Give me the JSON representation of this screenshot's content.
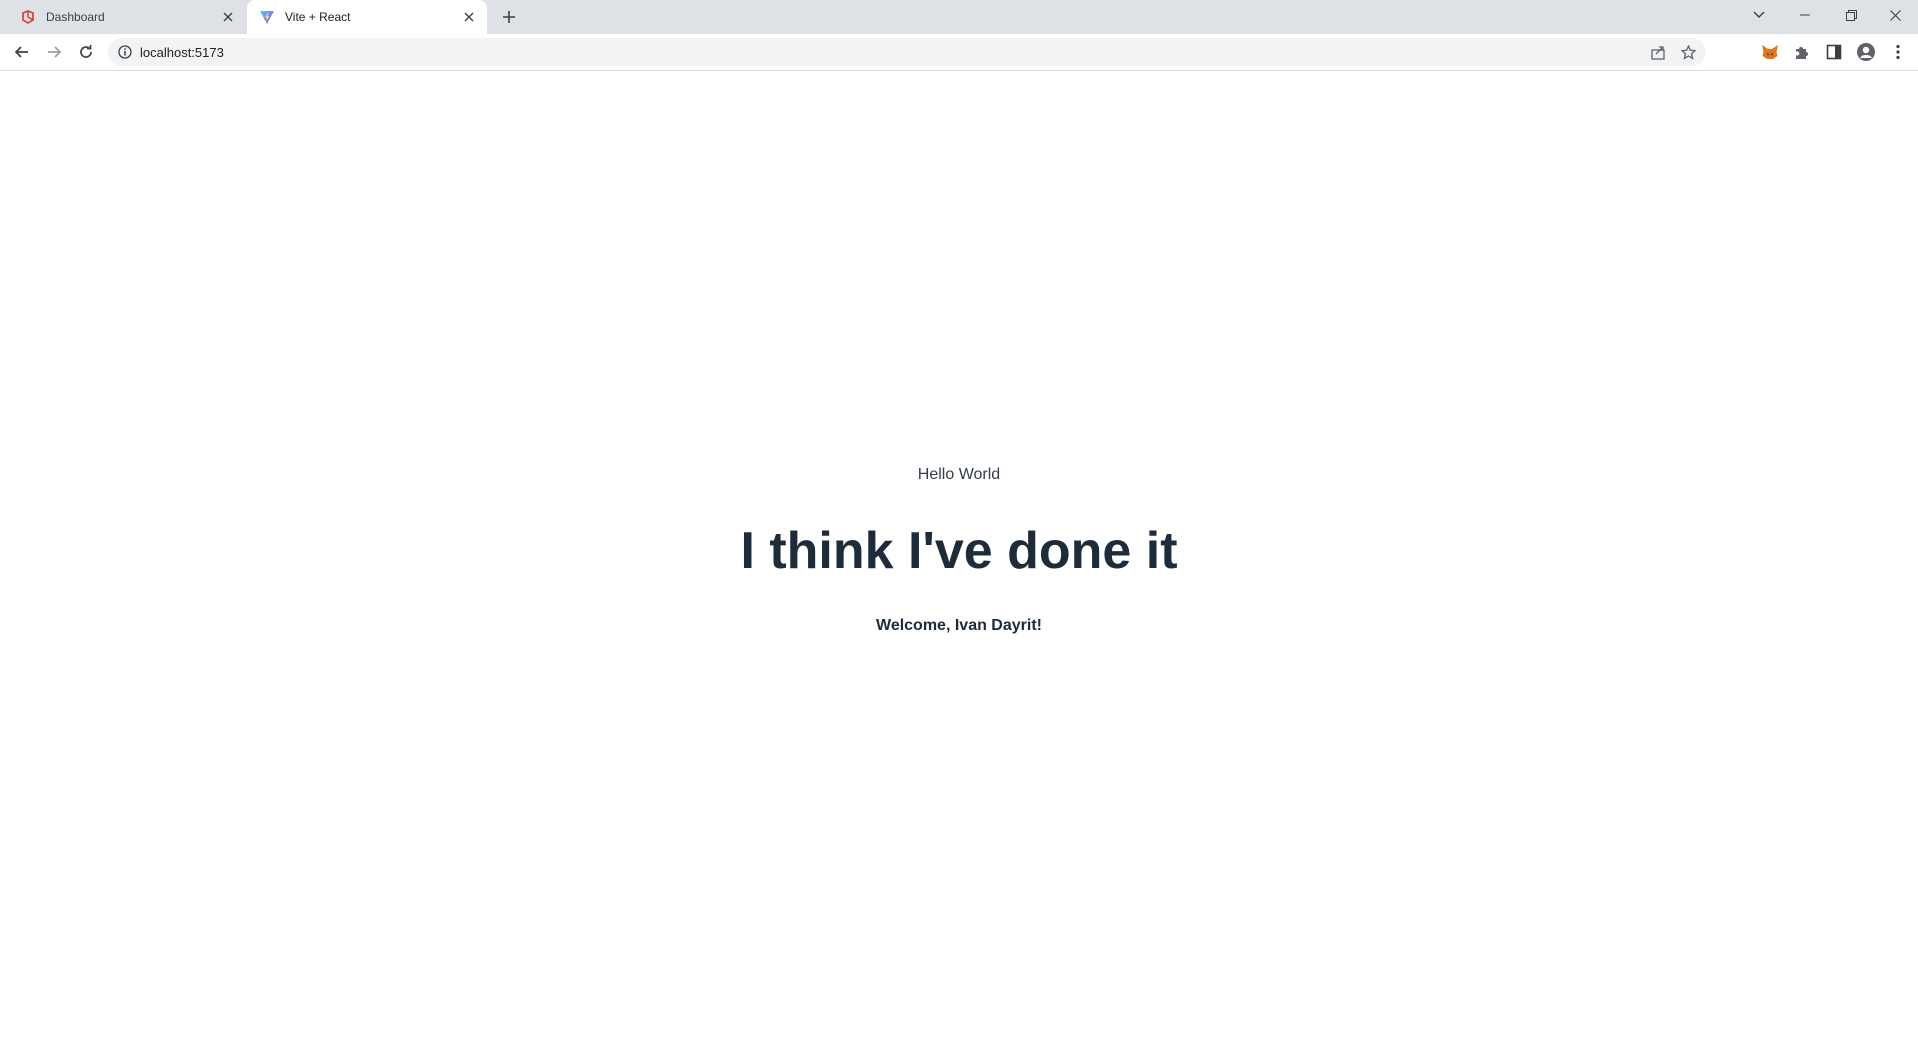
{
  "browser": {
    "tabs": [
      {
        "label": "Dashboard",
        "favicon": "laravel-logo-icon",
        "active": false
      },
      {
        "label": "Vite + React",
        "favicon": "vite-logo-icon",
        "active": true
      }
    ],
    "url": "localhost:5173"
  },
  "page": {
    "greeting": "Hello World",
    "headline": "I think I've done it",
    "welcome": "Welcome, Ivan Dayrit!"
  },
  "colors": {
    "tabstrip": "#dee1e6",
    "omnibox": "#f1f3f4",
    "text_dark": "#1e2b3b"
  }
}
